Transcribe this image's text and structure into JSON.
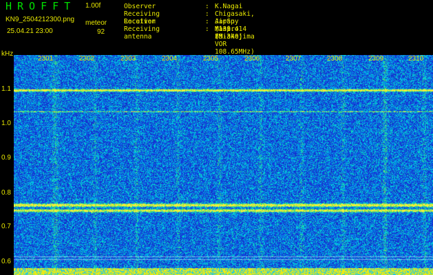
{
  "header": {
    "title": "HROFFT",
    "version": "1.00f",
    "filename": "KN9_2504212300.png",
    "datetime": "25.04.21 23:00",
    "meteor_label": "meteor",
    "meteor_count": "92"
  },
  "info": [
    {
      "key": "Observer",
      "value": "K.Nagai"
    },
    {
      "key": "Receiving Location",
      "value": "Chigasaki, Japan (139.414 35.340)"
    },
    {
      "key": "Receiver",
      "value": "AirSpy mini (Miakejima VOR 108.65MHz)"
    },
    {
      "key": "Receiving antenna",
      "value": "Maspro FM-3"
    }
  ],
  "y_axis": {
    "unit": "kHz",
    "ticks": [
      "1.1",
      "1.0",
      "0.9",
      "0.8",
      "0.7",
      "0.6"
    ]
  },
  "x_axis": {
    "ticks": [
      "2301",
      "2302",
      "2303",
      "2304",
      "2305",
      "2306",
      "2307",
      "2308",
      "2309",
      "2310"
    ]
  },
  "colors": {
    "background": "#000000",
    "label": "#e8e800",
    "title": "#00e000",
    "spectro_base": "#1a2fd8"
  }
}
